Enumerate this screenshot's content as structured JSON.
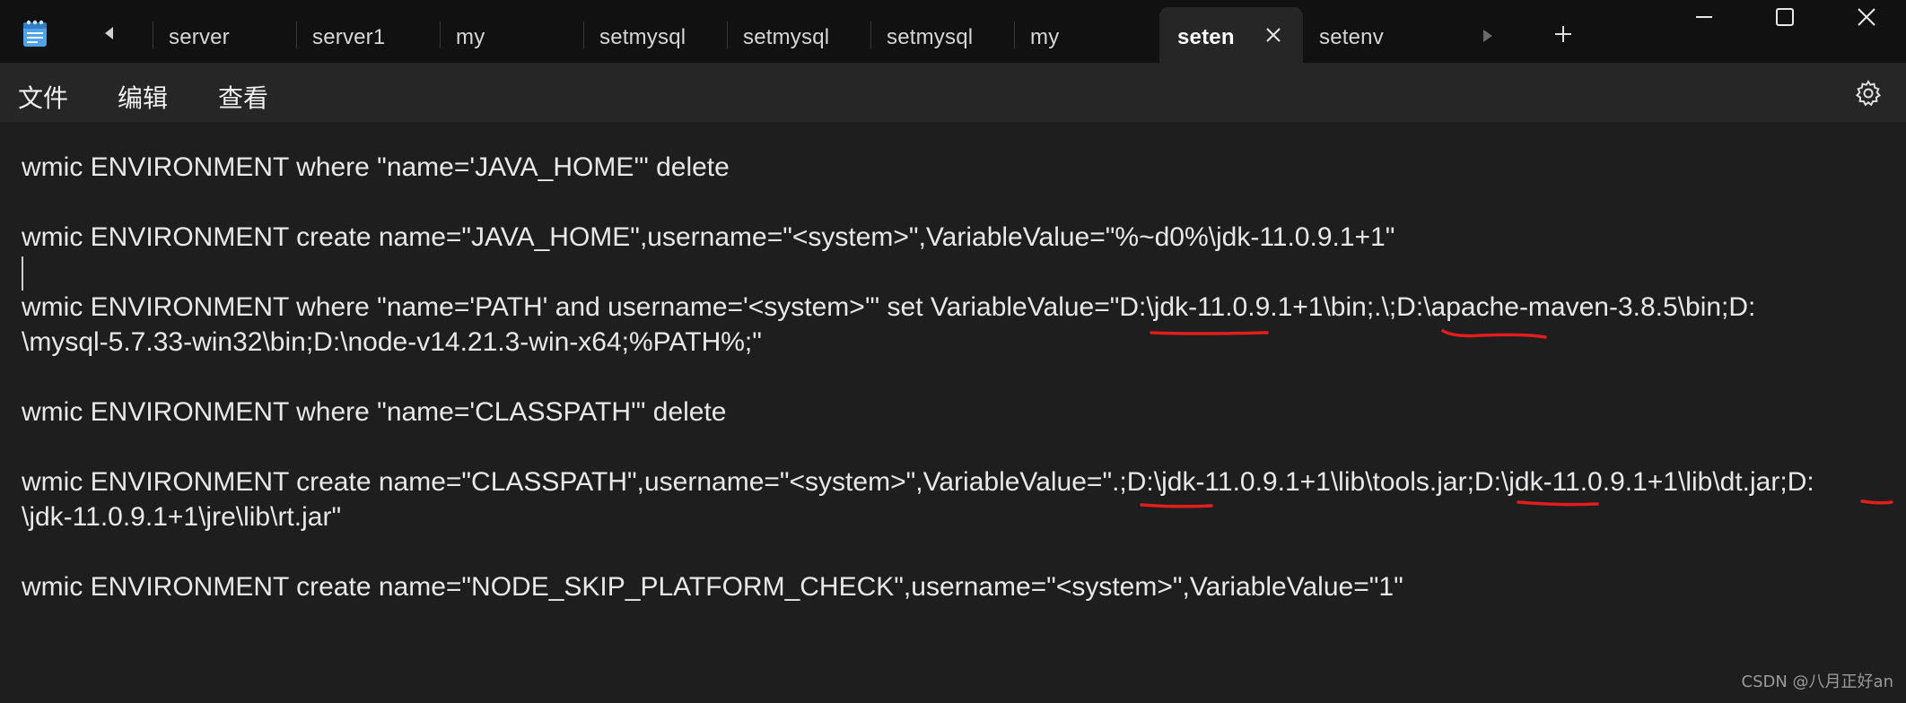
{
  "titlebar": {
    "tabs": [
      {
        "label": "server"
      },
      {
        "label": "server1"
      },
      {
        "label": "my"
      },
      {
        "label": "setmysql"
      },
      {
        "label": "setmysql"
      },
      {
        "label": "setmysql"
      },
      {
        "label": "my"
      },
      {
        "label": "seten"
      },
      {
        "label": "setenv"
      }
    ],
    "active_tab_index": 7
  },
  "menu": {
    "file": "文件",
    "edit": "编辑",
    "view": "查看"
  },
  "editor": {
    "lines": [
      "wmic ENVIRONMENT where \"name='JAVA_HOME'\" delete",
      "wmic ENVIRONMENT create name=\"JAVA_HOME\",username=\"<system>\",VariableValue=\"%~d0%\\jdk-11.0.9.1+1\"",
      "wmic ENVIRONMENT where \"name='PATH' and username='<system>'\" set VariableValue=\"D:\\jdk-11.0.9.1+1\\bin;.\\;D:\\apache-maven-3.8.5\\bin;D:",
      "\\mysql-5.7.33-win32\\bin;D:\\node-v14.21.3-win-x64;%PATH%;\"",
      "wmic ENVIRONMENT where \"name='CLASSPATH'\" delete",
      "wmic ENVIRONMENT create name=\"CLASSPATH\",username=\"<system>\",VariableValue=\".;D:\\jdk-11.0.9.1+1\\lib\\tools.jar;D:\\jdk-11.0.9.1+1\\lib\\dt.jar;D:",
      "\\jdk-11.0.9.1+1\\jre\\lib\\rt.jar\"",
      "wmic ENVIRONMENT create name=\"NODE_SKIP_PLATFORM_CHECK\",username=\"<system>\",VariableValue=\"1\""
    ]
  },
  "watermark": "CSDN @八月正好an",
  "colors": {
    "titlebar_bg": "#111111",
    "menubar_bg": "#262626",
    "editor_bg": "#1e1e1e",
    "annotation_red": "#e11d1d"
  }
}
